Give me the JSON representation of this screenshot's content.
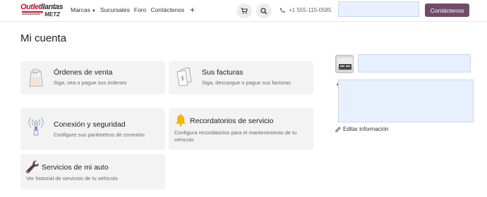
{
  "header": {
    "logo": {
      "main": "Outlet",
      "accent": "llantas",
      "tagline": "METZ"
    },
    "nav": [
      {
        "label": "Marcas",
        "has_dropdown": true
      },
      {
        "label": "Sucursales"
      },
      {
        "label": "Foro"
      },
      {
        "label": "Contáctenos"
      }
    ],
    "plus_icon": "plus-icon",
    "cart_icon": "cart-icon",
    "search_icon": "search-icon",
    "phone": "+1 555-115-0585",
    "search_value": "",
    "cta_label": "Contáctenos",
    "cta_color": "#714b67"
  },
  "page": {
    "title": "Mi cuenta"
  },
  "cards": [
    {
      "title": "Órdenes de venta",
      "desc": "Siga, vea o pague sus órdenes",
      "icon": "shopping-bag-icon"
    },
    {
      "title": "Sus facturas",
      "desc": "Siga, descargue o pague sus facturas",
      "icon": "invoice-icon"
    },
    {
      "title": "Conexión y seguridad",
      "desc": "Configure sus parámetros de conexión",
      "icon": "antenna-icon"
    },
    {
      "title": "Recordatorios de servicio",
      "desc": "Configura recordatorios para el mantenimiento de tu vehiculo",
      "icon": "bell-icon"
    },
    {
      "title": "Servicios de mi auto",
      "desc": "Ver historial de servicios de tu vehículo",
      "icon": "wrench-icon"
    }
  ],
  "sidebar": {
    "name_value": "",
    "address_value": "",
    "edit_label": "Editar información"
  }
}
